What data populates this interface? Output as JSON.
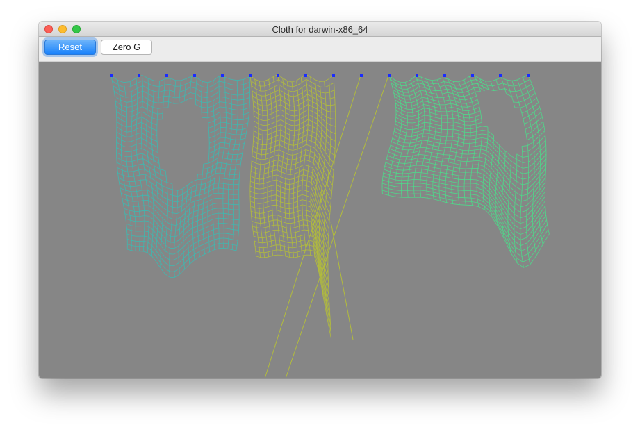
{
  "window": {
    "title": "Cloth for darwin-x86_64"
  },
  "toolbar": {
    "reset_label": "Reset",
    "zero_g_label": "Zero G"
  },
  "scene": {
    "background_color": "#868686",
    "pin_color": "#1a2cff",
    "cloths": [
      {
        "name": "cyan-cloth",
        "color": "#3fb8b0"
      },
      {
        "name": "olive-cloth",
        "color": "#b2bc3c"
      },
      {
        "name": "green-cloth",
        "color": "#4fd88a"
      }
    ]
  }
}
